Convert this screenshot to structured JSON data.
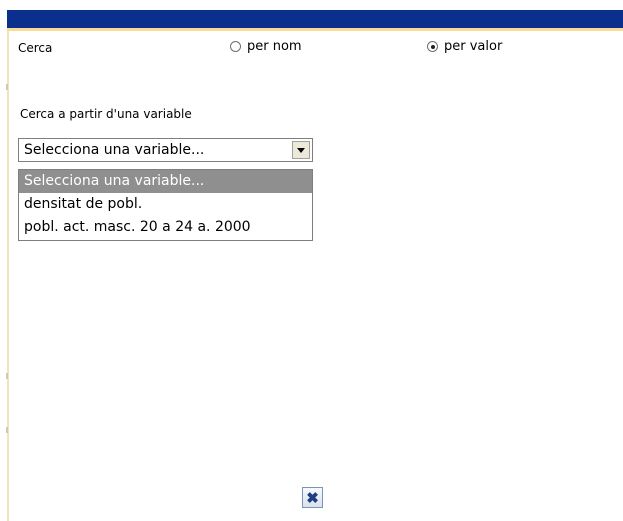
{
  "header": {
    "title_bar_color": "#0b2f8c",
    "accent_line_color": "#f6dc98"
  },
  "search": {
    "label": "Cerca",
    "options": [
      {
        "label": "per nom",
        "checked": false
      },
      {
        "label": "per valor",
        "checked": true
      }
    ]
  },
  "variable": {
    "label": "Cerca a partir d'una variable",
    "selected": "Selecciona una variable...",
    "options": [
      "Selecciona una variable...",
      "densitat de pobl.",
      "pobl. act. masc. 20 a 24 a. 2000"
    ],
    "highlight_color": "#8f8f8f"
  },
  "footer": {
    "close_icon": "close-icon",
    "close_glyph": "✖"
  }
}
